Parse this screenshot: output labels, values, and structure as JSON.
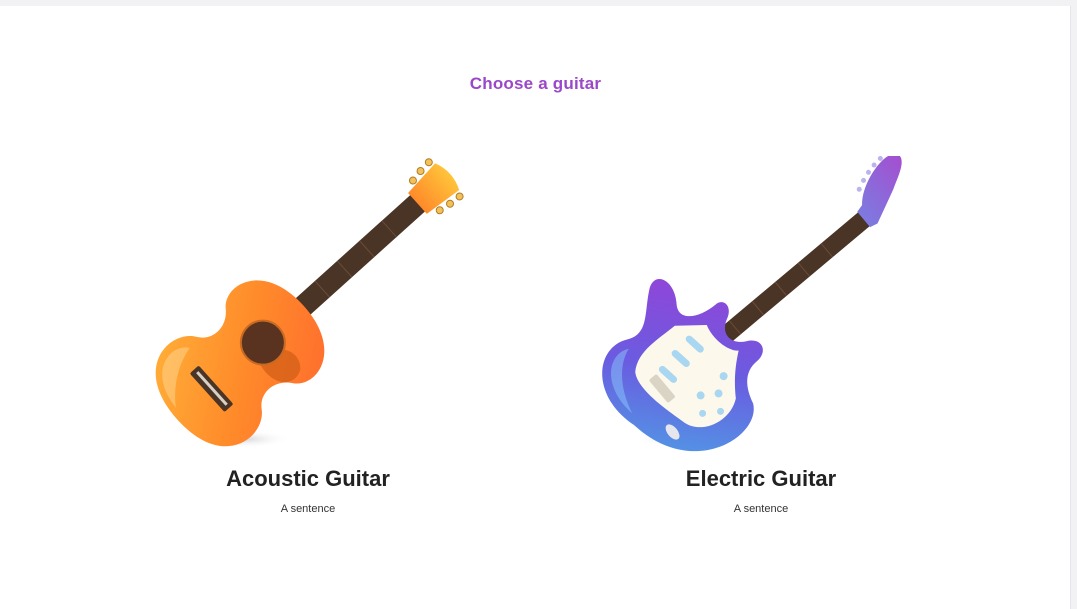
{
  "page": {
    "title": "Choose a guitar"
  },
  "colors": {
    "accent": "#9b47c9",
    "background": "#f2f2f4",
    "card": "#ffffff",
    "label": "#222222"
  },
  "options": [
    {
      "label": "Acoustic Guitar",
      "description": "A sentence",
      "icon": "acoustic-guitar-icon"
    },
    {
      "label": "Electric Guitar",
      "description": "A sentence",
      "icon": "electric-guitar-icon"
    }
  ]
}
